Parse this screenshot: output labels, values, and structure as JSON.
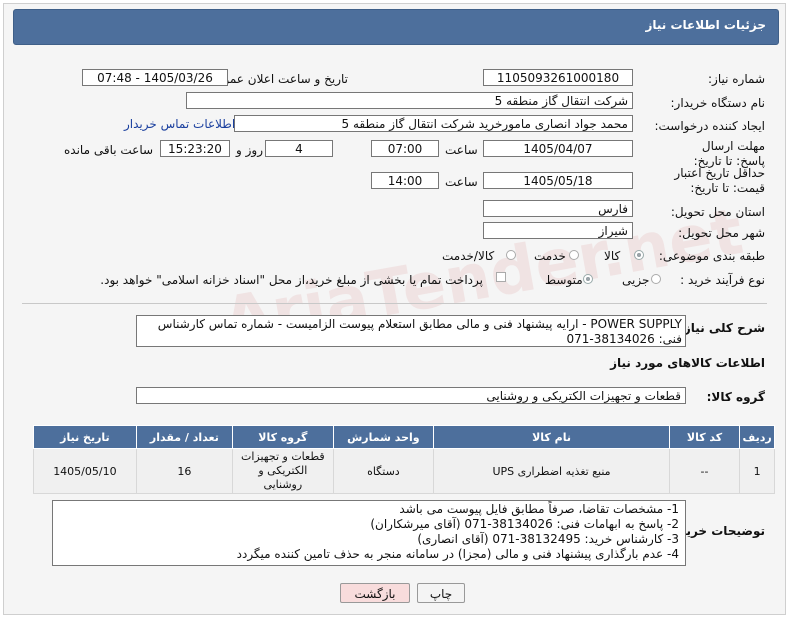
{
  "header": {
    "title": "جزئیات اطلاعات نیاز"
  },
  "form": {
    "need_number_label": "شماره نیاز:",
    "need_number": "1105093261000180",
    "announce_label": "تاریخ و ساعت اعلان عمومی:",
    "announce_value": "1405/03/26 - 07:48",
    "buyer_org_label": "نام دستگاه خریدار:",
    "buyer_org": "شرکت انتقال گاز منطقه 5",
    "creator_label": "ایجاد کننده درخواست:",
    "creator": "محمد جواد انصاری مامورخرید شرکت انتقال گاز منطقه 5",
    "contact_link": "اطلاعات تماس خریدار",
    "deadline_label": "مهلت ارسال پاسخ: تا تاریخ:",
    "deadline_date": "1405/04/07",
    "time_label": "ساعت",
    "deadline_time": "07:00",
    "days_value": "4",
    "days_label": "روز و",
    "remaining_time": "15:23:20",
    "remaining_label": "ساعت باقی مانده",
    "validity_label": "حداقل تاریخ اعتبار قیمت: تا تاریخ:",
    "validity_date": "1405/05/18",
    "validity_time": "14:00",
    "province_label": "استان محل تحویل:",
    "province": "فارس",
    "city_label": "شهر محل تحویل:",
    "city": "شیراز",
    "category_label": "طبقه بندی موضوعی:",
    "category_options": [
      "کالا",
      "خدمت",
      "کالا/خدمت"
    ],
    "process_label": "نوع فرآیند خرید :",
    "process_options": [
      "جزیی",
      "متوسط"
    ],
    "payment_note": "پرداخت تمام یا بخشی از مبلغ خرید،از محل \"اسناد خزانه اسلامی\" خواهد بود."
  },
  "description": {
    "label": "شرح کلی نیاز:",
    "line1": "POWER SUPPLY - ارایه پیشنهاد فنی و مالی مطابق استعلام پیوست الزامیست - شماره تماس کارشناس",
    "line2": "فنی: 38134026-071"
  },
  "goods_info_title": "اطلاعات کالاهای مورد نیاز",
  "goods_group": {
    "label": "گروه کالا:",
    "value": "قطعات و تجهیزات الکتریکی و روشنایی"
  },
  "table": {
    "headers": [
      "ردیف",
      "کد کالا",
      "نام کالا",
      "واحد شمارش",
      "گروه کالا",
      "تعداد / مقدار",
      "تاریخ نیاز"
    ],
    "rows": [
      {
        "row": "1",
        "code": "--",
        "name": "منبع تغذیه اضطراری UPS",
        "unit": "دستگاه",
        "group": "قطعات و تجهیزات الکتریکی و روشنایی",
        "qty": "16",
        "date": "1405/05/10"
      }
    ]
  },
  "buyer_notes": {
    "label": "توضیحات خریدار:",
    "lines": [
      "1-  مشخصات تقاضا، صرفاً مطابق فایل پیوست می باشد",
      "2- پاسخ به ابهامات فنی: 38134026-071 (آقای میرشکاران)",
      "3- کارشناس خرید: 38132495-071 (آقای انصاری)",
      "4- عدم بارگذاری پیشنهاد فنی و مالی (مجزا) در سامانه منجر به حذف تامین کننده میگردد"
    ]
  },
  "buttons": {
    "print": "چاپ",
    "back": "بازگشت"
  },
  "watermark": "AriaTender.net"
}
